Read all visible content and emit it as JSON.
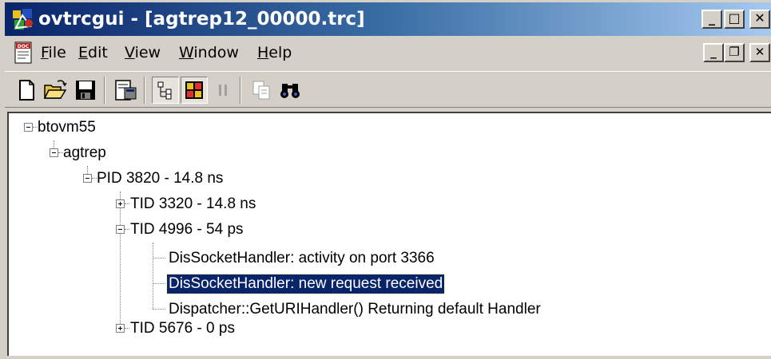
{
  "window": {
    "title": "ovtrcgui - [agtrep12_00000.trc]",
    "buttons": {
      "minimize": "_",
      "maximize": "□",
      "close": "✕"
    }
  },
  "menu": {
    "items": [
      {
        "label": "File"
      },
      {
        "label": "Edit"
      },
      {
        "label": "View"
      },
      {
        "label": "Window"
      },
      {
        "label": "Help"
      }
    ],
    "mdi_buttons": {
      "minimize": "_",
      "restore": "❐",
      "close": "✕"
    }
  },
  "toolbar": {
    "buttons": [
      "new-icon",
      "open-icon",
      "save-icon",
      "properties-icon",
      "tree-view-icon",
      "colors-icon",
      "pause-icon",
      "copy-icon",
      "find-icon"
    ]
  },
  "tree": {
    "nodes": [
      {
        "label": "btovm55",
        "expanded": true
      },
      {
        "label": "agtrep",
        "expanded": true
      },
      {
        "label": "PID 3820 - 14.8 ns",
        "expanded": true
      },
      {
        "label": "TID 3320 - 14.8 ns",
        "expanded": false
      },
      {
        "label": "TID 4996 - 54 ps",
        "expanded": true
      },
      {
        "label": "DisSocketHandler: activity on port 3366"
      },
      {
        "label": "DisSocketHandler: new request received",
        "selected": true
      },
      {
        "label": "Dispatcher::GetURIHandler() Returning default Handler"
      },
      {
        "label": "TID 5676 - 0 ps",
        "expanded": false
      }
    ]
  },
  "colors": {
    "title_start": "#0a246a",
    "title_end": "#a6caf0",
    "selection": "#0a246a",
    "face": "#d4d0c8"
  }
}
